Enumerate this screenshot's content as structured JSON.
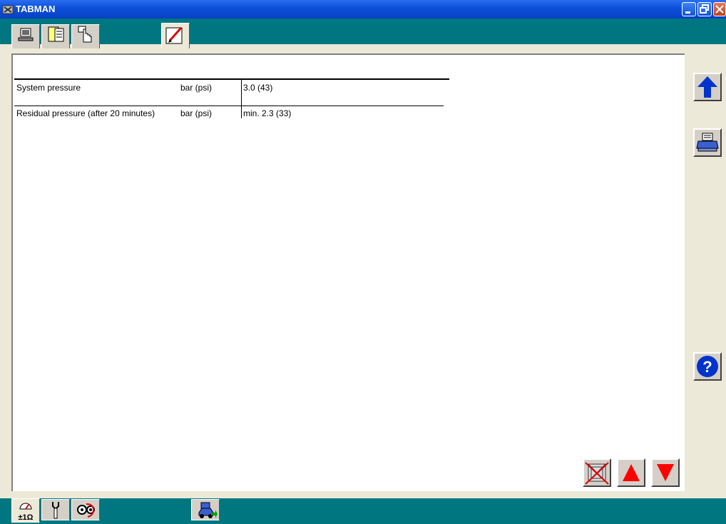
{
  "window": {
    "title": "TABMAN",
    "app_icon": "tabman-app-icon",
    "buttons": [
      "minimize-icon",
      "restore-icon",
      "close-icon"
    ]
  },
  "top_tabs": [
    {
      "icon": "computer-icon",
      "active": false
    },
    {
      "icon": "document-list-icon",
      "active": false
    },
    {
      "icon": "hand-pointer-icon",
      "active": false
    },
    {
      "icon": "pencil-edit-icon",
      "active": true
    }
  ],
  "table": {
    "rows": [
      {
        "parameter": "System pressure",
        "unit": "bar (psi)",
        "value": "3.0 (43)"
      },
      {
        "parameter": "Residual pressure (after 20 minutes)",
        "unit": "bar (psi)",
        "value": "min. 2.3 (33)"
      }
    ]
  },
  "side_buttons": [
    "arrow-up-icon",
    "printer-icon",
    "help-icon"
  ],
  "nav_buttons": [
    "cancel-icon",
    "triangle-up-icon",
    "triangle-down-icon"
  ],
  "bottom_tabs": [
    {
      "icon": "gauge-ohm-icon",
      "label": "±1Ω",
      "active": true
    },
    {
      "icon": "wrench-icon",
      "active": false
    },
    {
      "icon": "timing-belt-icon",
      "active": false
    },
    {
      "icon": "car-lift-icon",
      "active": false
    }
  ],
  "colors": {
    "titlebar": "#0a4fd8",
    "band": "#007780",
    "accent_blue": "#0033cc",
    "accent_red": "#ff0000"
  }
}
